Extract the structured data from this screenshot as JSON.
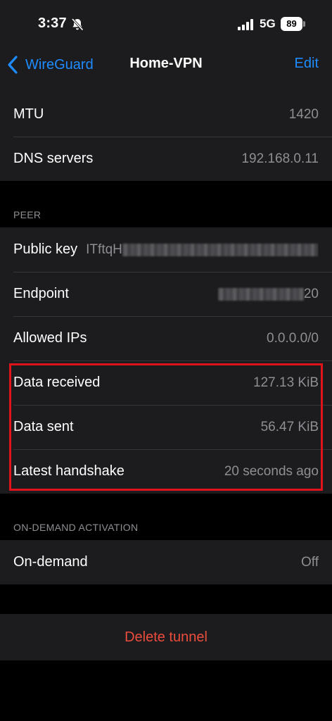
{
  "status_bar": {
    "time": "3:37",
    "network": "5G",
    "battery": "89"
  },
  "nav": {
    "back_label": "WireGuard",
    "title": "Home-VPN",
    "edit_label": "Edit"
  },
  "interface_rows": [
    {
      "label": "MTU",
      "value": "1420"
    },
    {
      "label": "DNS servers",
      "value": "192.168.0.11"
    }
  ],
  "peer": {
    "header": "PEER",
    "public_key_label": "Public key",
    "public_key_prefix": "ITftqH",
    "endpoint_label": "Endpoint",
    "endpoint_suffix": "20",
    "allowed_ips_label": "Allowed IPs",
    "allowed_ips_value": "0.0.0.0/0",
    "data_received_label": "Data received",
    "data_received_value": "127.13 KiB",
    "data_sent_label": "Data sent",
    "data_sent_value": "56.47 KiB",
    "latest_handshake_label": "Latest handshake",
    "latest_handshake_value": "20 seconds ago"
  },
  "on_demand": {
    "header": "ON-DEMAND ACTIVATION",
    "label": "On-demand",
    "value": "Off"
  },
  "delete_label": "Delete tunnel",
  "colors": {
    "accent": "#1e8cff",
    "destructive": "#eb4d3d",
    "highlight": "#e0121b"
  }
}
